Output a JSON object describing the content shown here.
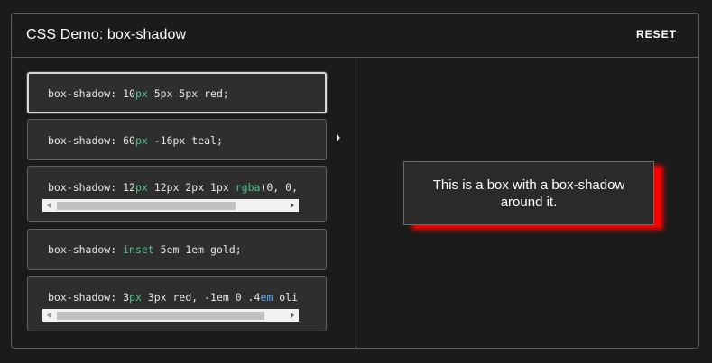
{
  "header": {
    "title": "CSS Demo: box-shadow",
    "reset_label": "RESET"
  },
  "options": [
    {
      "prop": "box-shadow: ",
      "parts": [
        "10",
        "px",
        " 5px 5px red;"
      ],
      "selected": true
    },
    {
      "prop": "box-shadow: ",
      "parts": [
        "60",
        "px",
        " -16px teal;"
      ],
      "selected": false
    },
    {
      "prop": "box-shadow: ",
      "parts": [
        "12",
        "px",
        " 12px 2px 1px ",
        "rgba",
        "(0, 0,"
      ],
      "selected": false
    },
    {
      "prop": "box-shadow: ",
      "parts": [
        "",
        "inset",
        " 5em 1em gold;"
      ],
      "selected": false
    },
    {
      "prop": "box-shadow: ",
      "parts": [
        "3",
        "px",
        " 3px red, -1em 0 .4",
        "em",
        " oli"
      ],
      "selected": false
    }
  ],
  "output": {
    "text": "This is a box with a box-shadow around it."
  },
  "colors": {
    "background": "#1b1b1b",
    "keyword": "#4fc08d",
    "unit_blue": "#57a8f5",
    "shadow": "red"
  },
  "icons": {
    "selected_indicator": "caret-right-icon",
    "scroll_left": "scroll-left-arrow-icon",
    "scroll_right": "scroll-right-arrow-icon"
  }
}
